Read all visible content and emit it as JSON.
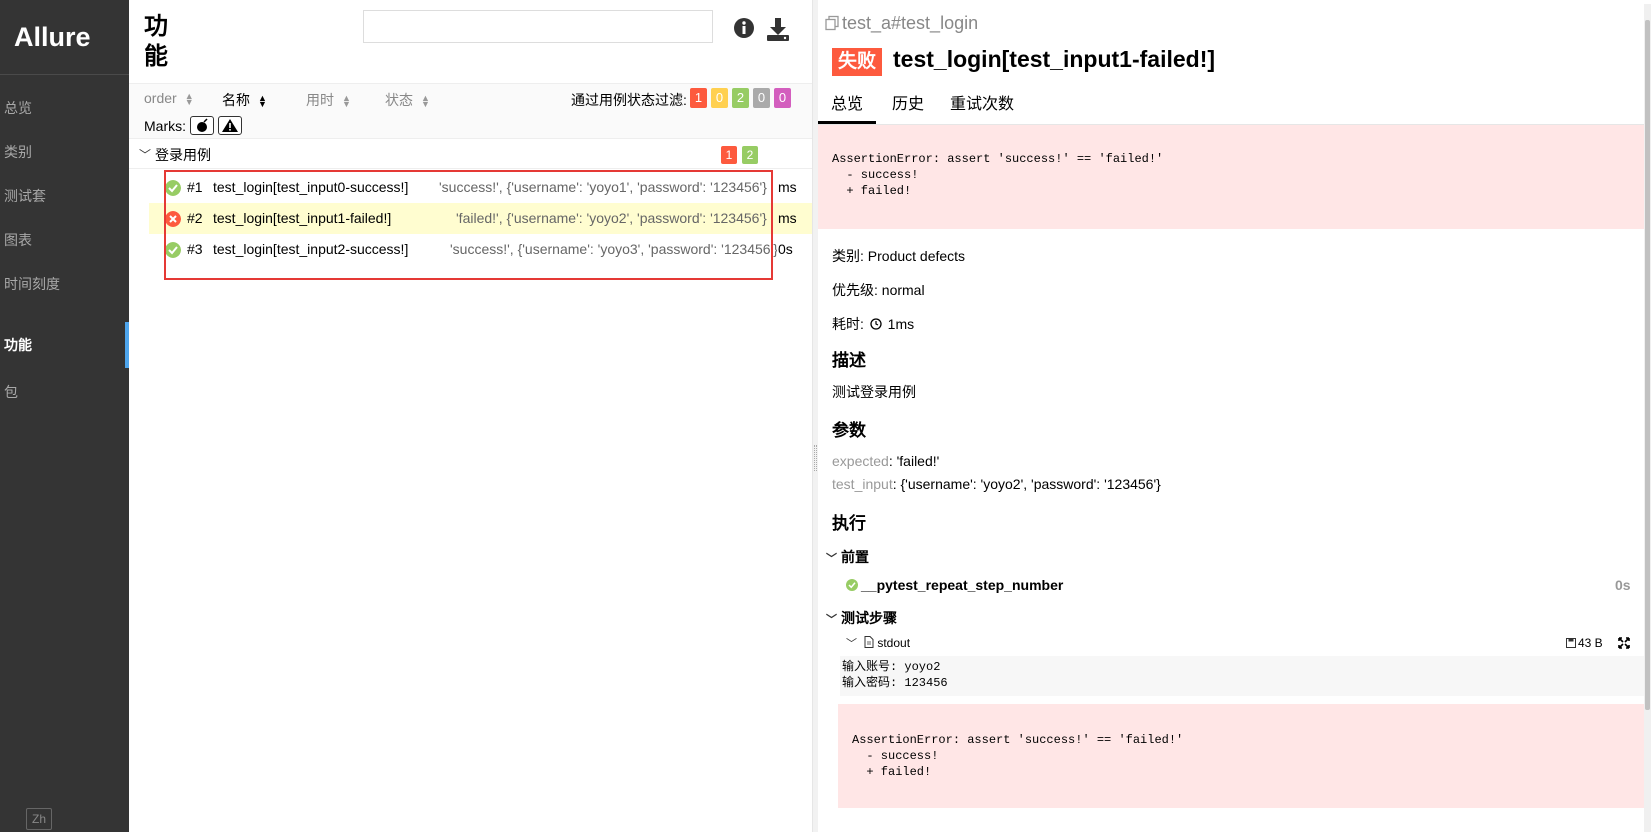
{
  "sidebar": {
    "brand": "Allure",
    "items": [
      {
        "label": "总览"
      },
      {
        "label": "类别"
      },
      {
        "label": "测试套"
      },
      {
        "label": "图表"
      },
      {
        "label": "时间刻度"
      },
      {
        "label": "功能"
      },
      {
        "label": "包"
      }
    ],
    "active_index": 5,
    "lang": "Zh"
  },
  "middle": {
    "title": "功能",
    "search": {
      "value": "",
      "placeholder": ""
    },
    "columns": [
      "order",
      "名称",
      "用时",
      "状态"
    ],
    "filter_label": "通过用例状态过滤:",
    "filter_badges": [
      {
        "count": "1",
        "color": "#fd5a3e"
      },
      {
        "count": "0",
        "color": "#ffd050"
      },
      {
        "count": "2",
        "color": "#97cc64"
      },
      {
        "count": "0",
        "color": "#aaaaaa"
      },
      {
        "count": "0",
        "color": "#d35ebe"
      }
    ],
    "marks_label": "Marks:",
    "group": {
      "label": "登录用例",
      "badges": [
        {
          "count": "1",
          "color": "#fd5a3e"
        },
        {
          "count": "2",
          "color": "#97cc64"
        }
      ]
    },
    "tests": [
      {
        "num": "#1",
        "name": "test_login[test_input0-success!]",
        "params": "'success!', {'username': 'yoyo1', 'password': '123456'}",
        "time": "ms",
        "status": "passed"
      },
      {
        "num": "#2",
        "name": "test_login[test_input1-failed!]",
        "params": "'failed!', {'username': 'yoyo2', 'password': '123456'}",
        "time": "ms",
        "status": "failed"
      },
      {
        "num": "#3",
        "name": "test_login[test_input2-success!]",
        "params": "'success!', {'username': 'yoyo3', 'password': '123456'}",
        "time": "0s",
        "status": "passed"
      }
    ]
  },
  "detail": {
    "crumb": "test_a#test_login",
    "status": "失败",
    "title": "test_login[test_input1-failed!]",
    "tabs": [
      "总览",
      "历史",
      "重试次数"
    ],
    "error": "AssertionError: assert 'success!' == 'failed!'\n  - success!\n  + failed!",
    "category_label": "类别:",
    "category": "Product defects",
    "severity_label": "优先级:",
    "severity": "normal",
    "duration_label": "耗时:",
    "duration": "1ms",
    "description_title": "描述",
    "description": "测试登录用例",
    "params_title": "参数",
    "params": [
      {
        "key": "expected",
        "value": "'failed!'"
      },
      {
        "key": "test_input",
        "value": "{'username': 'yoyo2', 'password': '123456'}"
      }
    ],
    "execution_title": "执行",
    "setup_title": "前置",
    "setup_step": "__pytest_repeat_step_number",
    "setup_time": "0s",
    "steps_title": "测试步骤",
    "attachment": "stdout",
    "attachment_size": "43 B",
    "stdout": "输入账号: yoyo2\n输入密码: 123456",
    "error2": "AssertionError: assert 'success!' == 'failed!'\n  - success!\n  + failed!"
  },
  "colors": {
    "passed": "#97cc64",
    "failed": "#fd5a3e",
    "sidebar_bg": "#343434"
  }
}
